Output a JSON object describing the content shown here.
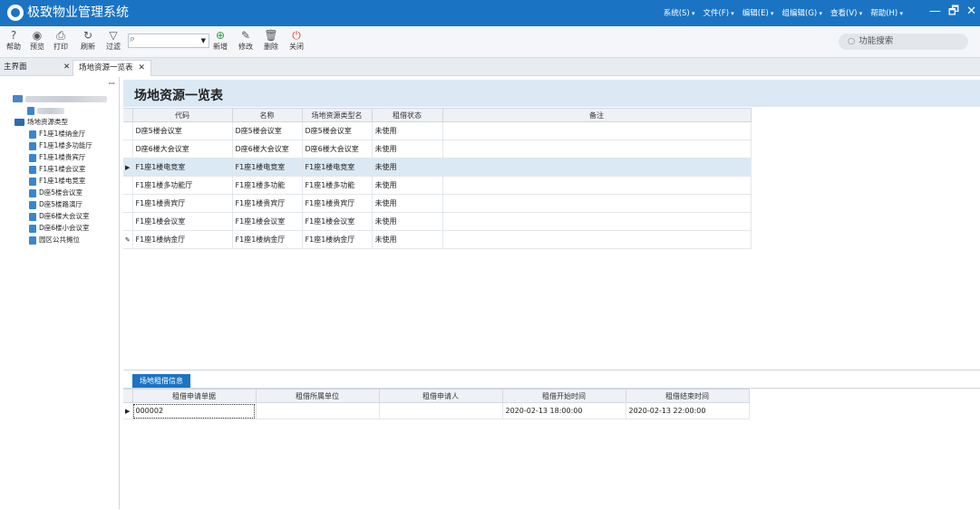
{
  "app": {
    "title": "极致物业管理系统"
  },
  "menu": [
    "系统(S)",
    "文件(F)",
    "编辑(E)",
    "组编辑(G)",
    "查看(V)",
    "帮助(H)"
  ],
  "window_controls": {
    "minimize": "—",
    "restore": "🗗",
    "close": "✕"
  },
  "toolbar": {
    "help": "帮助",
    "preview": "预览",
    "print": "打印",
    "refresh": "刷新",
    "filter": "过滤",
    "search_value": "",
    "add": "新增",
    "edit": "修改",
    "delete": "删除",
    "close": "关闭"
  },
  "function_search": {
    "placeholder": "功能搜索"
  },
  "tabs": [
    {
      "label": "主界面"
    },
    {
      "label": "场地资源一览表"
    }
  ],
  "sidebar": {
    "group_label": "场地资源类型",
    "items": [
      "F1座1楼纳金厅",
      "F1座1楼多功能厅",
      "F1座1楼贵宾厅",
      "F1座1楼会议室",
      "F1座1楼电竞室",
      "D座5楼会议室",
      "D座5楼路演厅",
      "D座6楼大会议室",
      "D座6楼小会议室",
      "园区公共摊位"
    ]
  },
  "main": {
    "title": "场地资源一览表",
    "columns": [
      "代码",
      "名称",
      "场地资源类型名",
      "租借状态",
      "备注"
    ],
    "rows": [
      [
        "D座5楼会议室",
        "D座5楼会议室",
        "D座5楼会议室",
        "未使用",
        ""
      ],
      [
        "D座6楼大会议室",
        "D座6楼大会议室",
        "D座6楼大会议室",
        "未使用",
        ""
      ],
      [
        "F1座1楼电竞室",
        "F1座1楼电竞室",
        "F1座1楼电竞室",
        "未使用",
        ""
      ],
      [
        "F1座1楼多功能厅",
        "F1座1楼多功能",
        "F1座1楼多功能",
        "未使用",
        ""
      ],
      [
        "F1座1楼贵宾厅",
        "F1座1楼贵宾厅",
        "F1座1楼贵宾厅",
        "未使用",
        ""
      ],
      [
        "F1座1楼会议室",
        "F1座1楼会议室",
        "F1座1楼会议室",
        "未使用",
        ""
      ],
      [
        "F1座1楼纳金厅",
        "F1座1楼纳金厅",
        "F1座1楼纳金厅",
        "未使用",
        ""
      ]
    ]
  },
  "detail": {
    "tab_label": "场地租借信息",
    "columns": [
      "租借申请单据",
      "租借所属单位",
      "租借申请人",
      "租借开始时间",
      "租借结束时间"
    ],
    "rows": [
      [
        "000002",
        "",
        "",
        "2020-02-13 18:00:00",
        "2020-02-13 22:00:00"
      ]
    ]
  }
}
